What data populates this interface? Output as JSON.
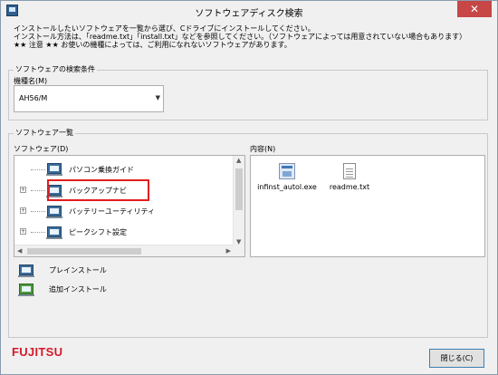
{
  "window": {
    "title": "ソフトウェアディスク検索",
    "close_glyph": "✕"
  },
  "description": {
    "line1": "インストールしたいソフトウェアを一覧から選び、Cドライブにインストールしてください。",
    "line2": "インストール方法は、「readme.txt」「install.txt」などを参照してください。（ソフトウェアによっては用意されていない場合もあります）",
    "line3": "★★ 注意 ★★ お使いの機種によっては、ご利用になれないソフトウェアがあります。"
  },
  "search_conditions": {
    "group_title": "ソフトウェアの検索条件",
    "model_label": "機種名(M)",
    "model_value": "AH56/M"
  },
  "software_list": {
    "group_title": "ソフトウェア一覧",
    "software_label": "ソフトウェア(D)",
    "contents_label": "内容(N)",
    "tree_items": [
      {
        "label": "パソコン乗換ガイド"
      },
      {
        "label": "バックアップナビ"
      },
      {
        "label": "バッテリーユーティリティ"
      },
      {
        "label": "ピークシフト設定"
      }
    ],
    "files": [
      {
        "name": "infinst_autol.exe",
        "icon": "exe-file-icon"
      },
      {
        "name": "readme.txt",
        "icon": "text-file-icon"
      }
    ]
  },
  "legend": {
    "preinstall": "プレインストール",
    "additional": "追加インストール"
  },
  "footer": {
    "logo": "FUJITSU",
    "close_button": "閉じる(C)"
  },
  "colors": {
    "highlight": "#e11d1d",
    "brand": "#d3192b",
    "preinstall_icon": "#3b6b9a",
    "additional_icon": "#4a9a3c"
  }
}
